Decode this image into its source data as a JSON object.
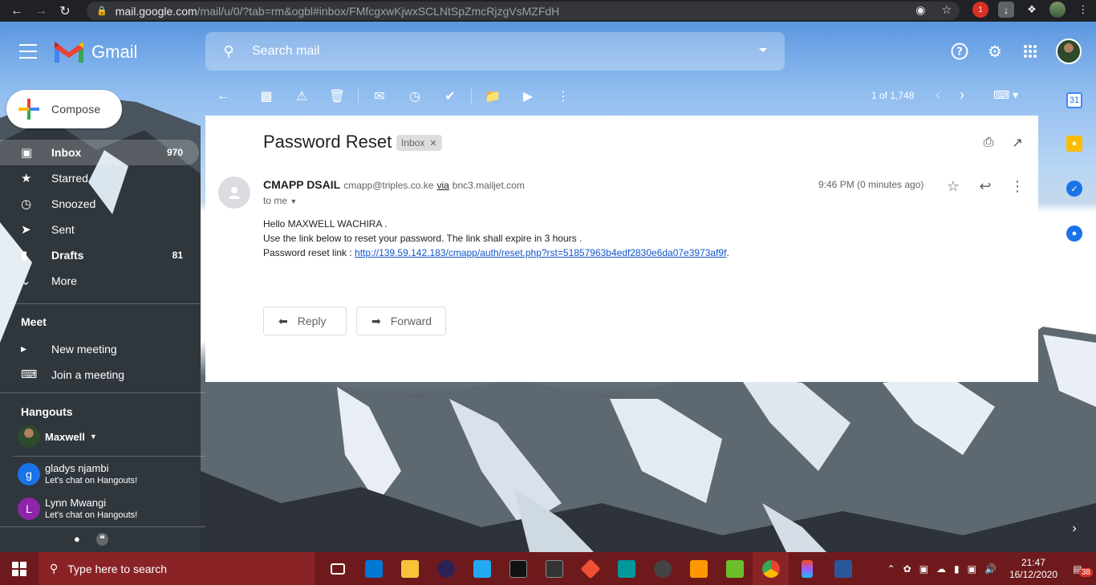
{
  "browser": {
    "url_host": "mail.google.com",
    "url_path": "/mail/u/0/?tab=rm&ogbl#inbox/FMfcgxwKjwxSCLNtSpZmcRjzgVsMZFdH",
    "ext_badge": "1"
  },
  "gmail": {
    "logo_text": "Gmail",
    "search_placeholder": "Search mail"
  },
  "sidebar": {
    "compose_label": "Compose",
    "items": [
      {
        "label": "Inbox",
        "count": "970",
        "icon": "inbox-icon"
      },
      {
        "label": "Starred",
        "count": "",
        "icon": "star-icon"
      },
      {
        "label": "Snoozed",
        "count": "",
        "icon": "clock-icon"
      },
      {
        "label": "Sent",
        "count": "",
        "icon": "send-icon"
      },
      {
        "label": "Drafts",
        "count": "81",
        "icon": "file-icon"
      },
      {
        "label": "More",
        "count": "",
        "icon": "chevron-down-icon"
      }
    ],
    "meet_title": "Meet",
    "meet_new": "New meeting",
    "meet_join": "Join a meeting",
    "hangouts_title": "Hangouts",
    "hangouts_user": "Maxwell",
    "contacts": [
      {
        "initial": "g",
        "name": "gladys njambi",
        "status": "Let's chat on Hangouts!",
        "color": "#1a73e8"
      },
      {
        "initial": "L",
        "name": "Lynn Mwangi",
        "status": "Let's chat on Hangouts!",
        "color": "#8e24aa"
      }
    ]
  },
  "toolbar": {
    "pager": "1 of 1,748"
  },
  "email": {
    "subject": "Password Reset",
    "label_chip": "Inbox",
    "sender_name": "CMAPP DSAIL",
    "sender_email": "cmapp@triples.co.ke",
    "via_label": "via",
    "via_domain": "bnc3.mailjet.com",
    "to_me": "to me",
    "time": "9:46 PM (0 minutes ago)",
    "line1": "Hello MAXWELL WACHIRA .",
    "line2": "Use the link below to reset your password. The link shall expire in 3 hours .",
    "line3_prefix": "Password reset link : ",
    "reset_link": "http://139.59.142.183/cmapp/auth/reset.php?rst=51857963b4edf2830e6da07e3973af9f",
    "line3_suffix": ".",
    "reply_label": "Reply",
    "forward_label": "Forward"
  },
  "taskbar": {
    "search_placeholder": "Type here to search",
    "time": "21:47",
    "date": "16/12/2020",
    "notif_count": "38"
  },
  "colors": {
    "taskbar": "#6e1a1c",
    "link": "#1155cc"
  }
}
